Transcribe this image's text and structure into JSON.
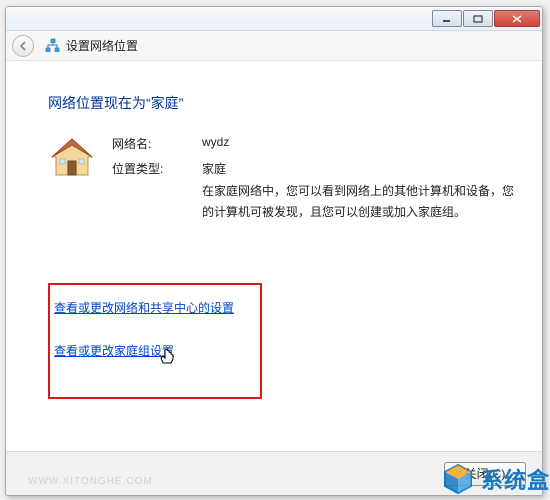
{
  "window": {
    "title": "设置网络位置"
  },
  "main": {
    "heading": "网络位置现在为“家庭”",
    "network_name_label": "网络名:",
    "network_name_value": "wydz",
    "location_type_label": "位置类型:",
    "location_type_value": "家庭",
    "description": "在家庭网络中，您可以看到网络上的其他计算机和设备，您的计算机可被发现，且您可以创建或加入家庭组。"
  },
  "links": {
    "view_network_sharing": "查看或更改网络和共享中心的设置",
    "view_homegroup": "查看或更改家庭组设置"
  },
  "footer": {
    "close_label": "关闭(C)"
  },
  "watermark": "WWW.XITONGHE.COM",
  "brand": "系统盒"
}
